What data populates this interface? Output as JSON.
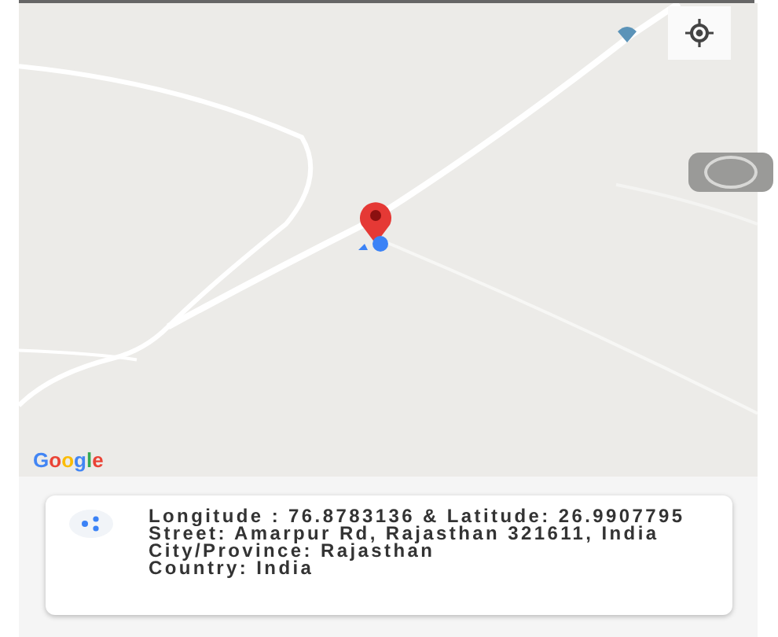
{
  "map": {
    "kind": "picture",
    "attribution": "Google"
  },
  "info_card": {
    "lines": [
      "Longitude : 76.8783136 & Latitude: 26.9907795",
      "Street: Amarpur Rd, Rajasthan 321611, India",
      "City/Province: Rajasthan",
      "Country: India"
    ]
  }
}
